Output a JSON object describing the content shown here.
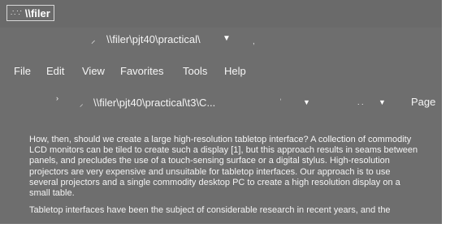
{
  "window": {
    "title": "\\\\filer"
  },
  "address_bar": {
    "path": "\\\\filer\\pjt40\\practical\\"
  },
  "menu": {
    "items": [
      {
        "label": "File"
      },
      {
        "label": "Edit"
      },
      {
        "label": "View"
      },
      {
        "label": "Favorites"
      },
      {
        "label": "Tools"
      },
      {
        "label": "Help"
      }
    ]
  },
  "toolbar": {
    "tab_path": "\\\\filer\\pjt40\\practical\\t3\\C...",
    "page_label": "Page"
  },
  "document": {
    "paragraph1_lines": [
      "How, then, should we create a large high-resolution tabletop interface? A collection of commodity",
      "LCD monitors can be tiled to create such a display [1], but this approach results in seams between",
      "panels, and precludes the use of a touch-sensing surface or a digital stylus. High-resolution",
      "projectors are very expensive and unsuitable for tabletop interfaces. Our approach is to use",
      "several projectors and a single commodity desktop PC to create a high resolution display on a",
      "small table."
    ],
    "paragraph2_lines": [
      "Tabletop interfaces have been the subject of considerable research in recent years, and the"
    ]
  },
  "icons": {
    "title": "app-logo-icon",
    "address": "folder-icon",
    "tab": "page-icon",
    "dropdown": "chevron-down-icon"
  },
  "colors": {
    "window_bg": "#6e6e6e",
    "text": "#f4f4f4",
    "frame": "#ffffff"
  }
}
